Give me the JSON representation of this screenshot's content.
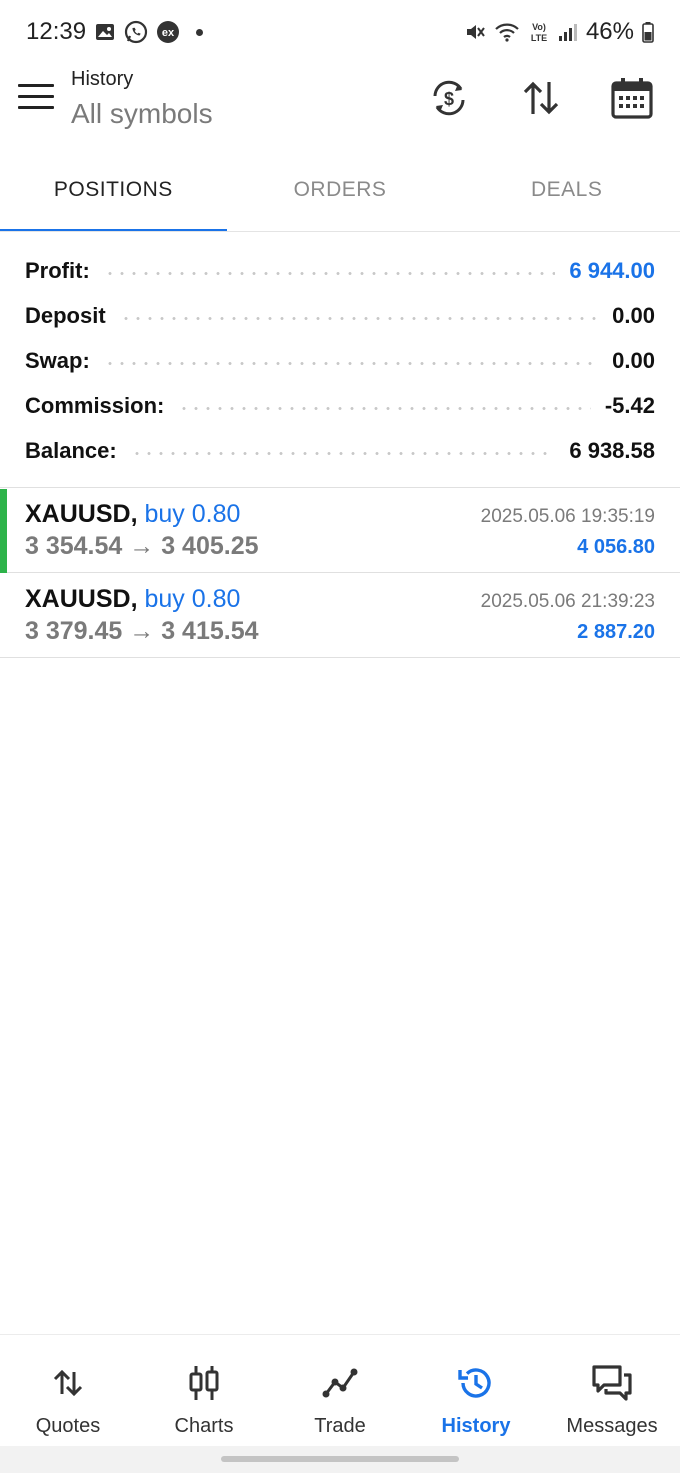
{
  "status_bar": {
    "time": "12:39",
    "battery": "46%"
  },
  "header": {
    "title": "History",
    "subtitle": "All symbols"
  },
  "tabs": [
    {
      "label": "POSITIONS",
      "active": true
    },
    {
      "label": "ORDERS",
      "active": false
    },
    {
      "label": "DEALS",
      "active": false
    }
  ],
  "summary": [
    {
      "label": "Profit:",
      "value": "6 944.00"
    },
    {
      "label": "Deposit",
      "value": "0.00"
    },
    {
      "label": "Swap:",
      "value": "0.00"
    },
    {
      "label": "Commission:",
      "value": "-5.42"
    },
    {
      "label": "Balance:",
      "value": "6 938.58"
    }
  ],
  "positions": [
    {
      "symbol": "XAUUSD,",
      "side": "buy 0.80",
      "prices": "3 354.54 → 3 405.25",
      "time": "2025.05.06 19:35:19",
      "profit": "4 056.80"
    },
    {
      "symbol": "XAUUSD,",
      "side": "buy 0.80",
      "prices": "3 379.45 → 3 415.54",
      "time": "2025.05.06 21:39:23",
      "profit": "2 887.20"
    }
  ],
  "bottom_nav": [
    {
      "label": "Quotes",
      "icon": "quotes-arrows-icon"
    },
    {
      "label": "Charts",
      "icon": "candlestick-icon"
    },
    {
      "label": "Trade",
      "icon": "trade-line-icon"
    },
    {
      "label": "History",
      "icon": "history-clock-icon",
      "active": true
    },
    {
      "label": "Messages",
      "icon": "messages-icon"
    }
  ],
  "colors": {
    "accent": "#1a73e8",
    "profit_marker": "#2db34a"
  }
}
